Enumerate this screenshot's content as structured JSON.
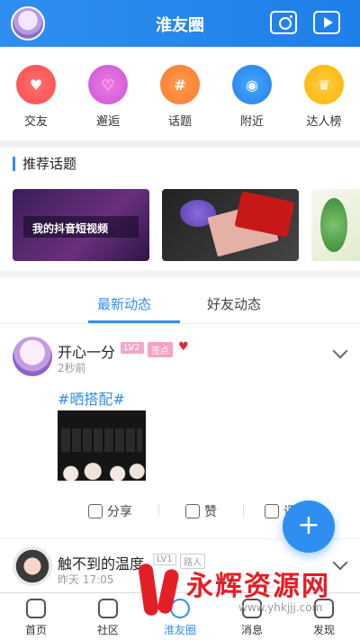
{
  "header": {
    "title": "淮友圈"
  },
  "categories": [
    {
      "label": "交友",
      "icon": "heart-icon",
      "color": "#ff5a5a"
    },
    {
      "label": "邂逅",
      "icon": "heartbeat-icon",
      "color": "#d663dc"
    },
    {
      "label": "话题",
      "icon": "hashtag-icon",
      "color": "#ff8538"
    },
    {
      "label": "附近",
      "icon": "location-icon",
      "color": "#2f8ff0"
    },
    {
      "label": "达人榜",
      "icon": "crown-icon",
      "color": "#ffc21f"
    }
  ],
  "recommend": {
    "title": "推荐话题",
    "card1_text": "我的抖音短视频"
  },
  "tabs": [
    {
      "label": "最新动态"
    },
    {
      "label": "好友动态"
    }
  ],
  "posts": [
    {
      "name": "开心一分",
      "level": "LV2",
      "tag": "签点",
      "time": "2秒前",
      "hashtag": "#晒搭配#",
      "share": "分享",
      "like": "赞",
      "comment": "评"
    },
    {
      "name": "触不到的温度",
      "level": "LV1",
      "tag": "路人",
      "time": "昨天 17:05"
    }
  ],
  "fab": {
    "symbol": "+"
  },
  "bottom_nav": [
    {
      "label": "首页"
    },
    {
      "label": "社区"
    },
    {
      "label": "淮友圈"
    },
    {
      "label": "消息"
    },
    {
      "label": "发现"
    }
  ],
  "watermark": {
    "text": "永辉资源网",
    "url": "www.yhkjjj.com"
  },
  "colors": {
    "primary": "#2f8ff0",
    "header_bg": "#2f8ff0",
    "watermark": "#e41e25"
  }
}
